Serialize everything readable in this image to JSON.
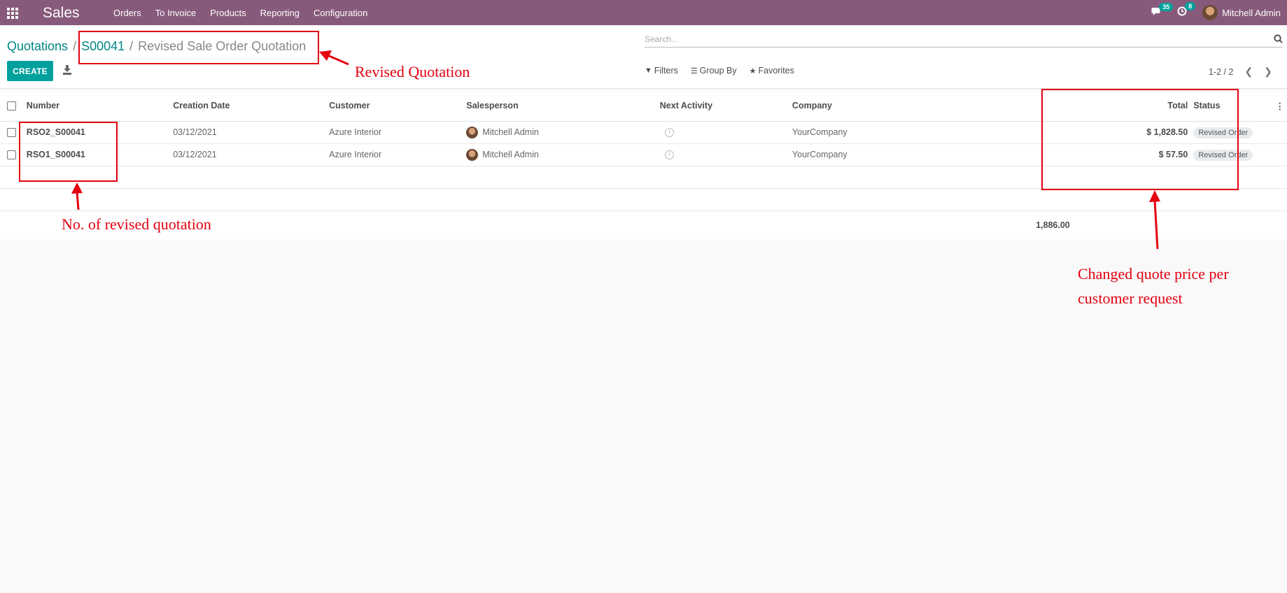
{
  "navbar": {
    "app_name": "Sales",
    "menu": [
      "Orders",
      "To Invoice",
      "Products",
      "Reporting",
      "Configuration"
    ],
    "messages_count": "35",
    "activities_count": "8",
    "user_name": "Mitchell Admin"
  },
  "breadcrumb": {
    "root": "Quotations",
    "order": "S00041",
    "current": "Revised Sale Order Quotation"
  },
  "toolbar": {
    "create_label": "CREATE",
    "search_placeholder": "Search...",
    "filters_label": "Filters",
    "groupby_label": "Group By",
    "favorites_label": "Favorites",
    "pager": "1-2 / 2"
  },
  "table": {
    "columns": [
      "Number",
      "Creation Date",
      "Customer",
      "Salesperson",
      "Next Activity",
      "Company",
      "Total",
      "Status"
    ],
    "rows": [
      {
        "number": "RSO2_S00041",
        "date": "03/12/2021",
        "customer": "Azure Interior",
        "salesperson": "Mitchell Admin",
        "company": "YourCompany",
        "total": "$ 1,828.50",
        "status": "Revised Order"
      },
      {
        "number": "RSO1_S00041",
        "date": "03/12/2021",
        "customer": "Azure Interior",
        "salesperson": "Mitchell Admin",
        "company": "YourCompany",
        "total": "$ 57.50",
        "status": "Revised Order"
      }
    ],
    "sum_total": "1,886.00"
  },
  "annotations": {
    "revised_quotation": "Revised Quotation",
    "no_of_revised": "No. of revised quotation",
    "changed_price_line1": "Changed quote price per",
    "changed_price_line2": "customer request"
  },
  "colors": {
    "navbar": "#875a7b",
    "primary": "#00a09d",
    "annotation": "#e4000f"
  }
}
